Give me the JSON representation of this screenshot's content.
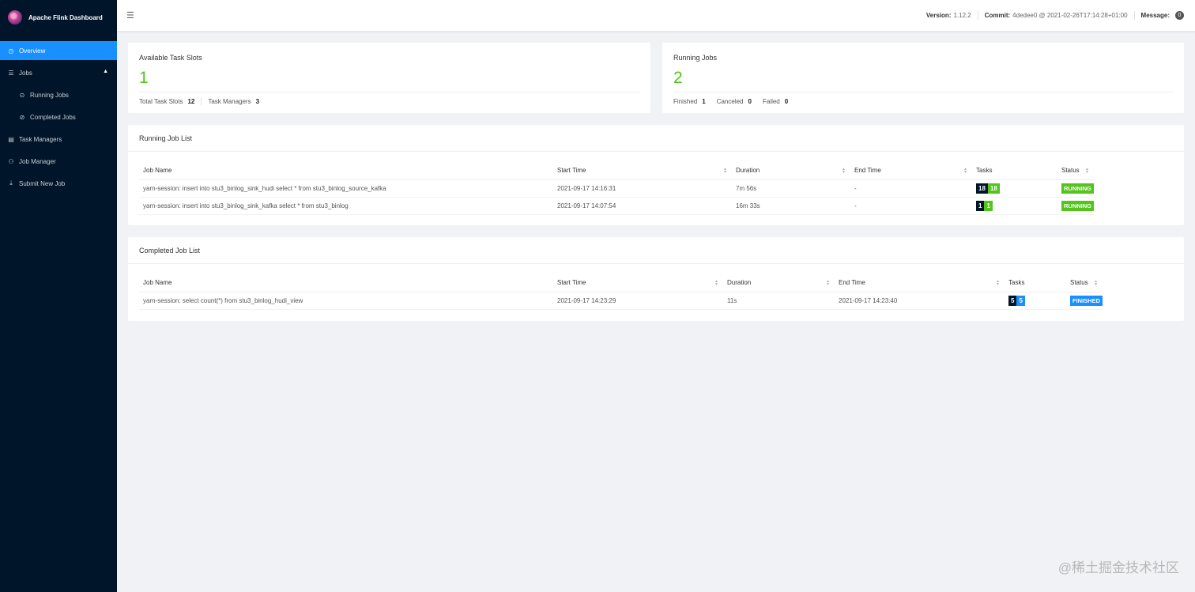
{
  "app": {
    "title": "Apache Flink Dashboard"
  },
  "sidebar": {
    "items": [
      {
        "label": "Overview",
        "icon": "dashboard-icon",
        "glyph": "◷"
      },
      {
        "label": "Jobs",
        "icon": "jobs-icon",
        "glyph": "☰"
      },
      {
        "label": "Running Jobs",
        "icon": "play-circle-icon",
        "glyph": "⊙"
      },
      {
        "label": "Completed Jobs",
        "icon": "check-circle-icon",
        "glyph": "⊘"
      },
      {
        "label": "Task Managers",
        "icon": "schedule-icon",
        "glyph": "▤"
      },
      {
        "label": "Job Manager",
        "icon": "cluster-icon",
        "glyph": "⚇"
      },
      {
        "label": "Submit New Job",
        "icon": "upload-icon",
        "glyph": "⤓"
      }
    ]
  },
  "header": {
    "version_label": "Version:",
    "version": "1.12.2",
    "commit_label": "Commit:",
    "commit": "4dedee0 @ 2021-02-26T17:14:28+01:00",
    "message_label": "Message:",
    "message_count": "0"
  },
  "task_slots": {
    "title": "Available Task Slots",
    "available": "1",
    "total_label": "Total Task Slots",
    "total": "12",
    "tm_label": "Task Managers",
    "tm": "3"
  },
  "running_jobs_card": {
    "title": "Running Jobs",
    "count": "2",
    "finished_label": "Finished",
    "finished": "1",
    "canceled_label": "Canceled",
    "canceled": "0",
    "failed_label": "Failed",
    "failed": "0"
  },
  "running_list": {
    "title": "Running Job List",
    "columns": [
      "Job Name",
      "Start Time",
      "Duration",
      "End Time",
      "Tasks",
      "Status"
    ],
    "rows": [
      {
        "name": "yarn-session: insert into stu3_binlog_sink_hudi select * from stu3_binlog_source_kafka",
        "start": "2021-09-17 14:16:31",
        "duration": "7m 56s",
        "end": "-",
        "tasks_total": "18",
        "tasks_state": "18",
        "status": "RUNNING"
      },
      {
        "name": "yarn-session: insert into stu3_binlog_sink_kafka select * from stu3_binlog",
        "start": "2021-09-17 14:07:54",
        "duration": "16m 33s",
        "end": "-",
        "tasks_total": "1",
        "tasks_state": "1",
        "status": "RUNNING"
      }
    ]
  },
  "completed_list": {
    "title": "Completed Job List",
    "columns": [
      "Job Name",
      "Start Time",
      "Duration",
      "End Time",
      "Tasks",
      "Status"
    ],
    "rows": [
      {
        "name": "yarn-session: select count(*) from stu3_binlog_hudi_view",
        "start": "2021-09-17 14:23:29",
        "duration": "11s",
        "end": "2021-09-17 14:23:40",
        "tasks_total": "5",
        "tasks_state": "5",
        "status": "FINISHED"
      }
    ]
  },
  "watermark": "@稀土掘金技术社区",
  "colors": {
    "sidebar": "#001529",
    "accent": "#1890ff",
    "success": "#52c41a"
  }
}
